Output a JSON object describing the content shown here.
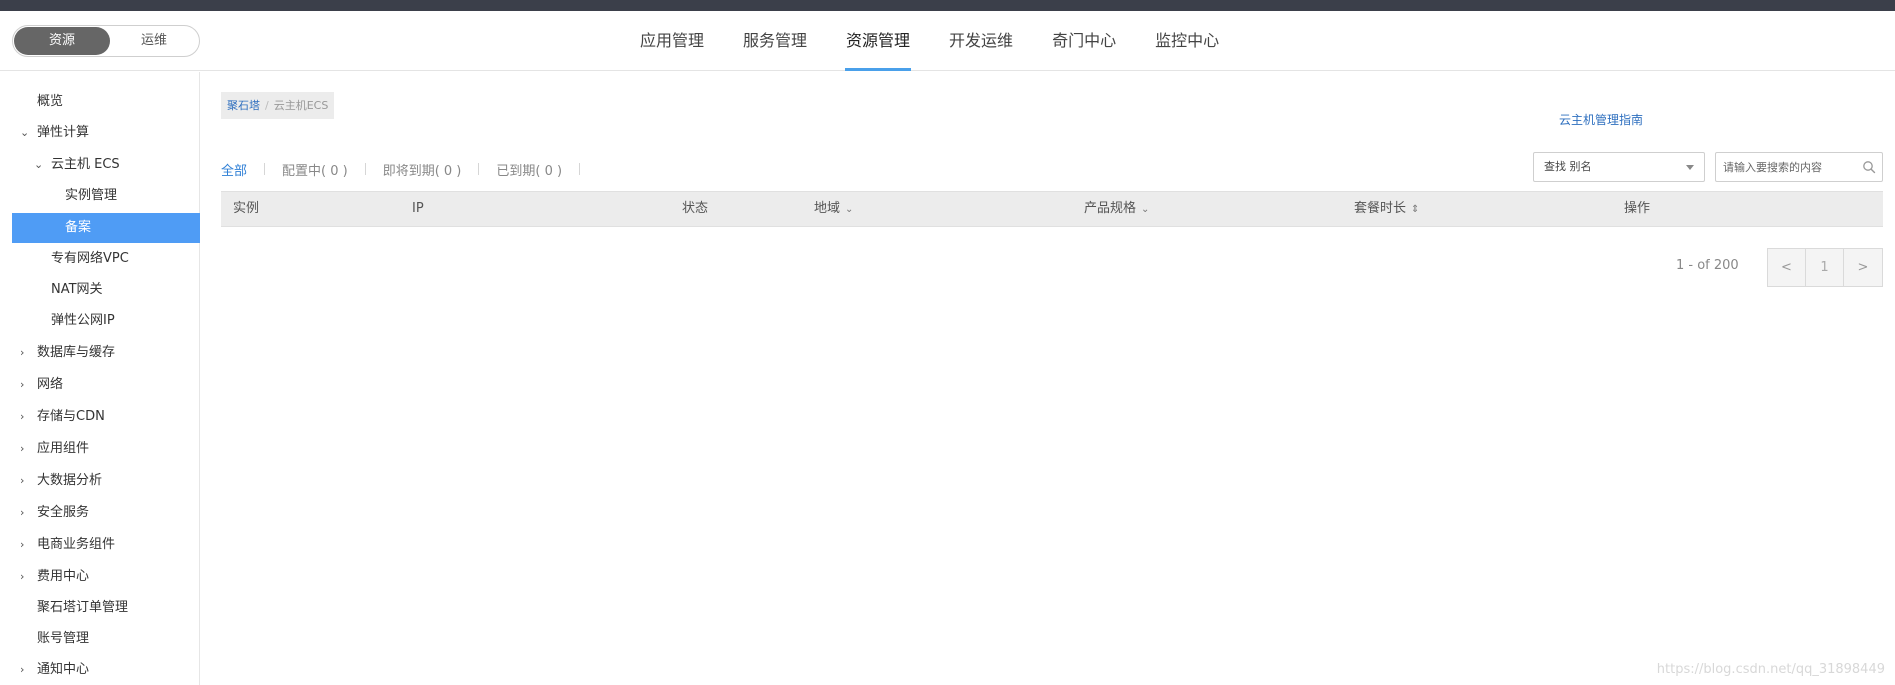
{
  "header": {
    "toggle": {
      "active": "资源",
      "inactive": "运维"
    },
    "nav": [
      "应用管理",
      "服务管理",
      "资源管理",
      "开发运维",
      "奇门中心",
      "监控中心"
    ],
    "active_nav": "资源管理"
  },
  "sidebar": {
    "items": [
      {
        "label": "概览",
        "expand": ""
      },
      {
        "label": "弹性计算",
        "expand": "down"
      },
      {
        "label": "云主机 ECS",
        "expand": "down"
      },
      {
        "label": "实例管理",
        "expand": ""
      },
      {
        "label": "备案",
        "expand": "",
        "selected": true
      },
      {
        "label": "专有网络VPC",
        "expand": ""
      },
      {
        "label": "NAT网关",
        "expand": ""
      },
      {
        "label": "弹性公网IP",
        "expand": ""
      },
      {
        "label": "数据库与缓存",
        "expand": "right"
      },
      {
        "label": "网络",
        "expand": "right"
      },
      {
        "label": "存储与CDN",
        "expand": "right"
      },
      {
        "label": "应用组件",
        "expand": "right"
      },
      {
        "label": "大数据分析",
        "expand": "right"
      },
      {
        "label": "安全服务",
        "expand": "right"
      },
      {
        "label": "电商业务组件",
        "expand": "right"
      },
      {
        "label": "费用中心",
        "expand": "right"
      },
      {
        "label": "聚石塔订单管理",
        "expand": ""
      },
      {
        "label": "账号管理",
        "expand": ""
      },
      {
        "label": "通知中心",
        "expand": "right"
      }
    ]
  },
  "breadcrumb": {
    "root": "聚石塔",
    "separator": "/",
    "current": "云主机ECS"
  },
  "guide_link": "云主机管理指南",
  "tabs": [
    "全部",
    "配置中( 0 )",
    "即将到期( 0 )",
    "已到期( 0 )"
  ],
  "filter": {
    "select_value": "查找 别名",
    "search_placeholder": "请输入要搜索的内容"
  },
  "table": {
    "columns": [
      "实例",
      "IP",
      "状态",
      "地域",
      "产品规格",
      "套餐时长",
      "操作"
    ],
    "sort_marks": [
      "",
      "",
      "",
      "⌄",
      "⌄",
      "⇕",
      ""
    ],
    "rows": []
  },
  "pagination": {
    "info": "1 - of 200",
    "prev": "<",
    "page": "1",
    "next": ">"
  },
  "watermark": "https://blog.csdn.net/qq_31898449"
}
